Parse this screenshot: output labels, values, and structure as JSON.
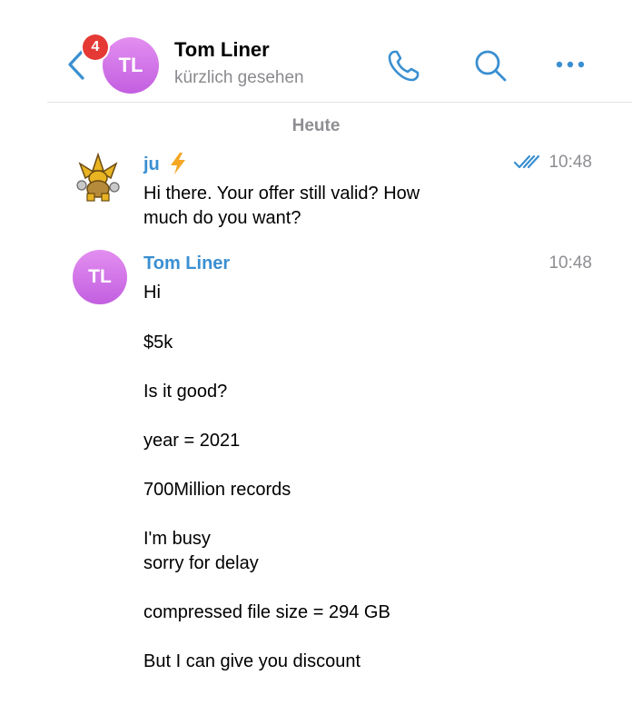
{
  "header": {
    "unread_count": "4",
    "contact_initials": "TL",
    "contact_name": "Tom Liner",
    "status": "kürzlich gesehen",
    "icons": [
      "back-icon",
      "phone-icon",
      "search-icon",
      "more-icon"
    ]
  },
  "date_separator": "Heute",
  "messages": [
    {
      "sender": "ju",
      "sender_icon": "lightning-bolt-icon",
      "time": "10:48",
      "status_icon": "double-check-icon",
      "lines": [
        "Hi there. Your offer still valid? How",
        "much do you want?"
      ]
    },
    {
      "sender": "Tom Liner",
      "initials": "TL",
      "time": "10:48",
      "lines": [
        "Hi",
        "$5k",
        "Is it good?",
        "year = 2021",
        "700Million records",
        "I'm busy",
        "sorry for delay",
        "compressed file size = 294 GB",
        "But I can give you discount"
      ]
    }
  ],
  "colors": {
    "accent": "#3a8fd1",
    "icon_blue": "#3a8fd1",
    "badge_red": "#e53935",
    "avatar_gradient": [
      "#e38ef0",
      "#c25fe0"
    ],
    "muted_gray": "#8e8e93"
  }
}
